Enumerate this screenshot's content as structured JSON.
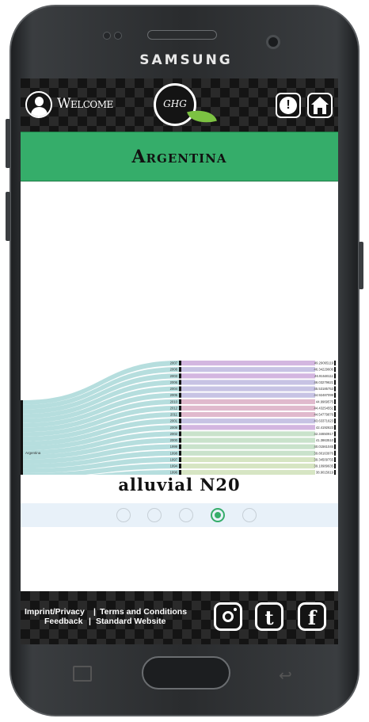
{
  "device": {
    "brand": "SAMSUNG"
  },
  "header": {
    "welcome_label": "Welcome",
    "logo_text": "GHG",
    "info_icon": "exclamation-icon",
    "home_icon": "home-icon"
  },
  "country": {
    "name": "Argentina"
  },
  "chart_title": "alluvial N20",
  "carousel": {
    "pages": 5,
    "active_index": 3
  },
  "footer": {
    "imprint": "Imprint/Privacy",
    "terms": "Terms and Conditions",
    "feedback": "Feedback",
    "standard_website": "Standard Website",
    "separator": "|",
    "social": [
      "instagram-icon",
      "tumblr-icon",
      "facebook-icon"
    ]
  },
  "colors": {
    "accent": "#35ad6a",
    "header_bg": "#141414",
    "source_flow": "#a9d8d8"
  },
  "chart_data": {
    "type": "alluvial",
    "source": "Argentina",
    "flows": [
      {
        "year": "2007",
        "value": "49.29065119",
        "color": "#d3b6e0"
      },
      {
        "year": "2008",
        "value": "46.34229606",
        "color": "#c7c3e4"
      },
      {
        "year": "2003",
        "value": "46.91646111",
        "color": "#d3b6e0"
      },
      {
        "year": "2006",
        "value": "46.03279621",
        "color": "#c7c3e4"
      },
      {
        "year": "2004",
        "value": "45.53185753",
        "color": "#c7c3e4"
      },
      {
        "year": "2005",
        "value": "44.92487099",
        "color": "#c7c3e4"
      },
      {
        "year": "2010",
        "value": "44.9969575",
        "color": "#e0b9cd"
      },
      {
        "year": "2012",
        "value": "44.43254551",
        "color": "#e0b9cd"
      },
      {
        "year": "2011",
        "value": "44.54779876",
        "color": "#e0b9cd"
      },
      {
        "year": "2001",
        "value": "43.63371623",
        "color": "#c7c3e4"
      },
      {
        "year": "2009",
        "value": "42.4192623",
        "color": "#d3b6e0"
      },
      {
        "year": "2002",
        "value": "42.34650917",
        "color": "#c9e2cb"
      },
      {
        "year": "2000",
        "value": "41.3863510",
        "color": "#c9e2cb"
      },
      {
        "year": "1999",
        "value": "40.01561045",
        "color": "#c9e2cb"
      },
      {
        "year": "1998",
        "value": "39.80163976",
        "color": "#c9e2cb"
      },
      {
        "year": "1997",
        "value": "39.34509755",
        "color": "#d6e5c3"
      },
      {
        "year": "1994",
        "value": "39.10989635",
        "color": "#d6e5c3"
      },
      {
        "year": "1996",
        "value": "38.9015619",
        "color": "#d6e5c3"
      },
      {
        "year": "1995",
        "value": "38.58715684",
        "color": "#d6e5c3"
      },
      {
        "year": "1992",
        "value": "38.38137134",
        "color": "#e6e0c3"
      },
      {
        "year": "1993",
        "value": "37.93487498",
        "color": "#e6e0c3"
      },
      {
        "year": "1990",
        "value": "37.5323248",
        "color": "#e8c1c3"
      },
      {
        "year": "1991",
        "value": "37.66719182",
        "color": "#e8c1c3"
      }
    ]
  }
}
